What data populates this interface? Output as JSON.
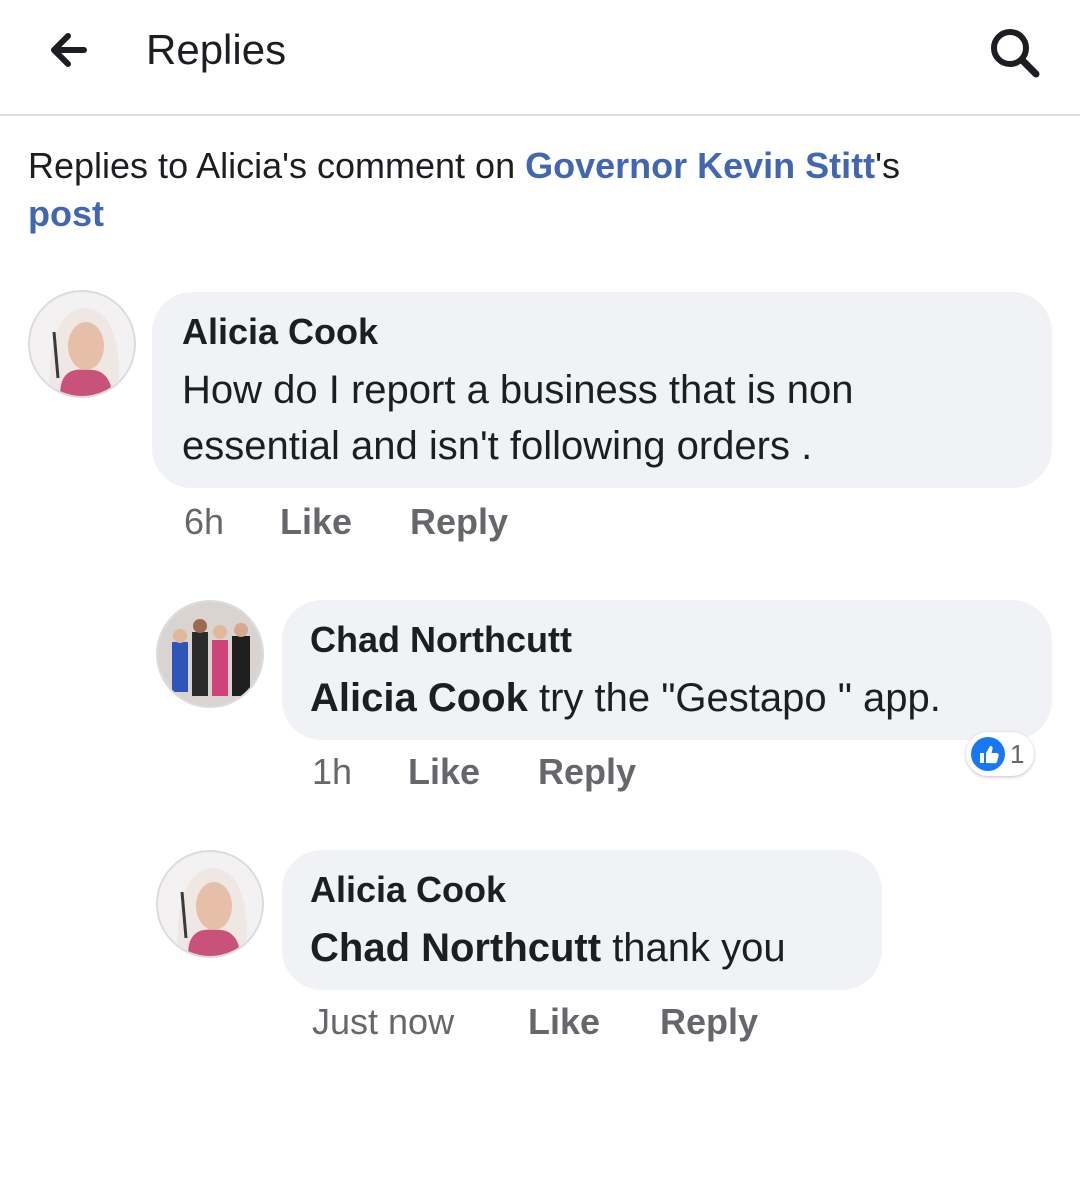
{
  "header": {
    "title": "Replies",
    "back_icon": "arrow-left-icon",
    "search_icon": "search-icon"
  },
  "context": {
    "prefix": "Replies to Alicia's comment on ",
    "page_link": "Governor Kevin Stitt",
    "middle": "'s",
    "post_link": "post"
  },
  "comments": [
    {
      "author": "Alicia Cook",
      "mention": "",
      "text": "How do I report a business that is non essential and isn't following orders .",
      "timestamp": "6h",
      "like_label": "Like",
      "reply_label": "Reply"
    },
    {
      "author": "Chad Northcutt",
      "mention": "Alicia Cook",
      "text": " try the \"Gestapo \" app.",
      "timestamp": "1h",
      "like_label": "Like",
      "reply_label": "Reply",
      "reactions": {
        "icon": "thumbs-up-icon",
        "count": "1"
      }
    },
    {
      "author": "Alicia Cook",
      "mention": "Chad Northcutt",
      "text": " thank you",
      "timestamp": "Just now",
      "like_label": "Like",
      "reply_label": "Reply"
    }
  ],
  "colors": {
    "link": "#4267b2",
    "bubble": "#f0f2f5",
    "meta_text": "#65676b",
    "like_blue": "#1877f2"
  }
}
